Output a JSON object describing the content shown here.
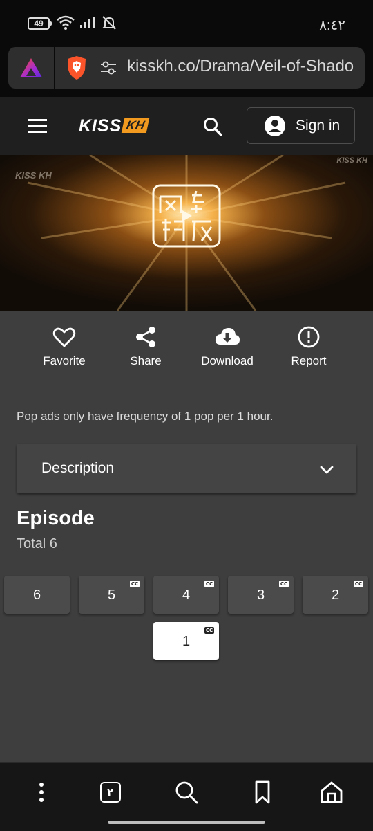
{
  "status_bar": {
    "battery": "49",
    "time": "٨:٤٢"
  },
  "browser": {
    "url": "kisskh.co/Drama/Veil-of-Shado",
    "tab_count": "٢"
  },
  "site": {
    "logo_text": "KISS",
    "logo_badge": "KH",
    "signin_label": "Sign in"
  },
  "hero": {
    "watermark_left": "KISS KH",
    "watermark_right": "KISS KH"
  },
  "actions": [
    {
      "label": "Favorite",
      "icon": "heart-icon"
    },
    {
      "label": "Share",
      "icon": "share-icon"
    },
    {
      "label": "Download",
      "icon": "cloud-download-icon"
    },
    {
      "label": "Report",
      "icon": "alert-circle-icon"
    }
  ],
  "notice": "Pop ads only have frequency of 1 pop per 1 hour.",
  "description": {
    "label": "Description"
  },
  "episodes": {
    "title": "Episode",
    "total": "Total 6",
    "cc_label": "CC",
    "items": [
      {
        "number": "6",
        "cc": false,
        "active": false
      },
      {
        "number": "5",
        "cc": true,
        "active": false
      },
      {
        "number": "4",
        "cc": true,
        "active": false
      },
      {
        "number": "3",
        "cc": true,
        "active": false
      },
      {
        "number": "2",
        "cc": true,
        "active": false
      },
      {
        "number": "1",
        "cc": true,
        "active": true
      }
    ]
  },
  "colors": {
    "accent": "#f29a1f",
    "page_bg": "#3e3e3e",
    "header_bg": "#1f1f1f"
  }
}
